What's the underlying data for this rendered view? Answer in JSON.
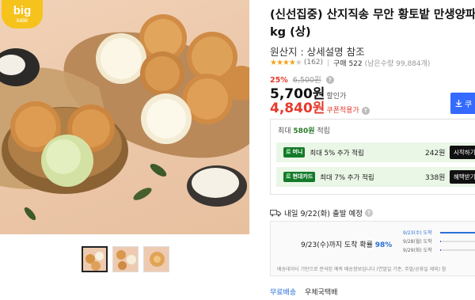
{
  "badge": {
    "line1": "big",
    "line2": "sale"
  },
  "gallery": {
    "thumb_count": 3,
    "active_thumb": 0
  },
  "product": {
    "title_line1": "(신선집중) 산지직송 무안 황토밭 만생양파 3",
    "title_line2": "kg (상)",
    "origin": "원산지 : 상세설명 참조",
    "rating": {
      "stars": 4.5,
      "review_count": "(162)",
      "sold": "구매 522",
      "stock": "(남은수량 99,884개)"
    },
    "discount_rate": "25%",
    "original_price": "6,500원",
    "price": "5,700원",
    "price_label": "할인가",
    "coupon_price": "4,840원",
    "coupon_label": "쿠폰적용가"
  },
  "buy_button": {
    "icon": "download-icon",
    "label": "쿠"
  },
  "rewards": {
    "heading_prefix": "최대 ",
    "heading_amount": "580원",
    "heading_suffix": " 적립",
    "rows": [
      {
        "tag_mark": "로",
        "tag": "머니",
        "text": "최대 5% 추가 적립",
        "amount": "242원",
        "button": "시작하기"
      },
      {
        "tag_mark": "로",
        "tag": "현대카드",
        "text": "최대 7% 추가 적립",
        "amount": "338원",
        "button": "혜택받기"
      }
    ]
  },
  "shipping": {
    "eta": "내일 9/22(화) 출발 예정",
    "prob_prefix": "9/23(수)까지 도착 확률 ",
    "prob_value": "98%",
    "rows": [
      {
        "label": "9/23(수) 도착",
        "value": 0.98
      },
      {
        "label": "9/28(월) 도착",
        "value": 0.01
      },
      {
        "label": "9/29(화) 도착",
        "value": 0.01
      }
    ],
    "note": "배송데이터 기반으로 분석된 예측 배송정보입니다 (연말일 기준, 주말/공휴일 제외) 참",
    "tab_free": "무료배송",
    "tab_type": "우체국택배"
  },
  "colors": {
    "accent_blue": "#346aff",
    "discount_red": "#e6392b",
    "reward_green": "#137a2a",
    "badge_yellow": "#f6c21c"
  }
}
